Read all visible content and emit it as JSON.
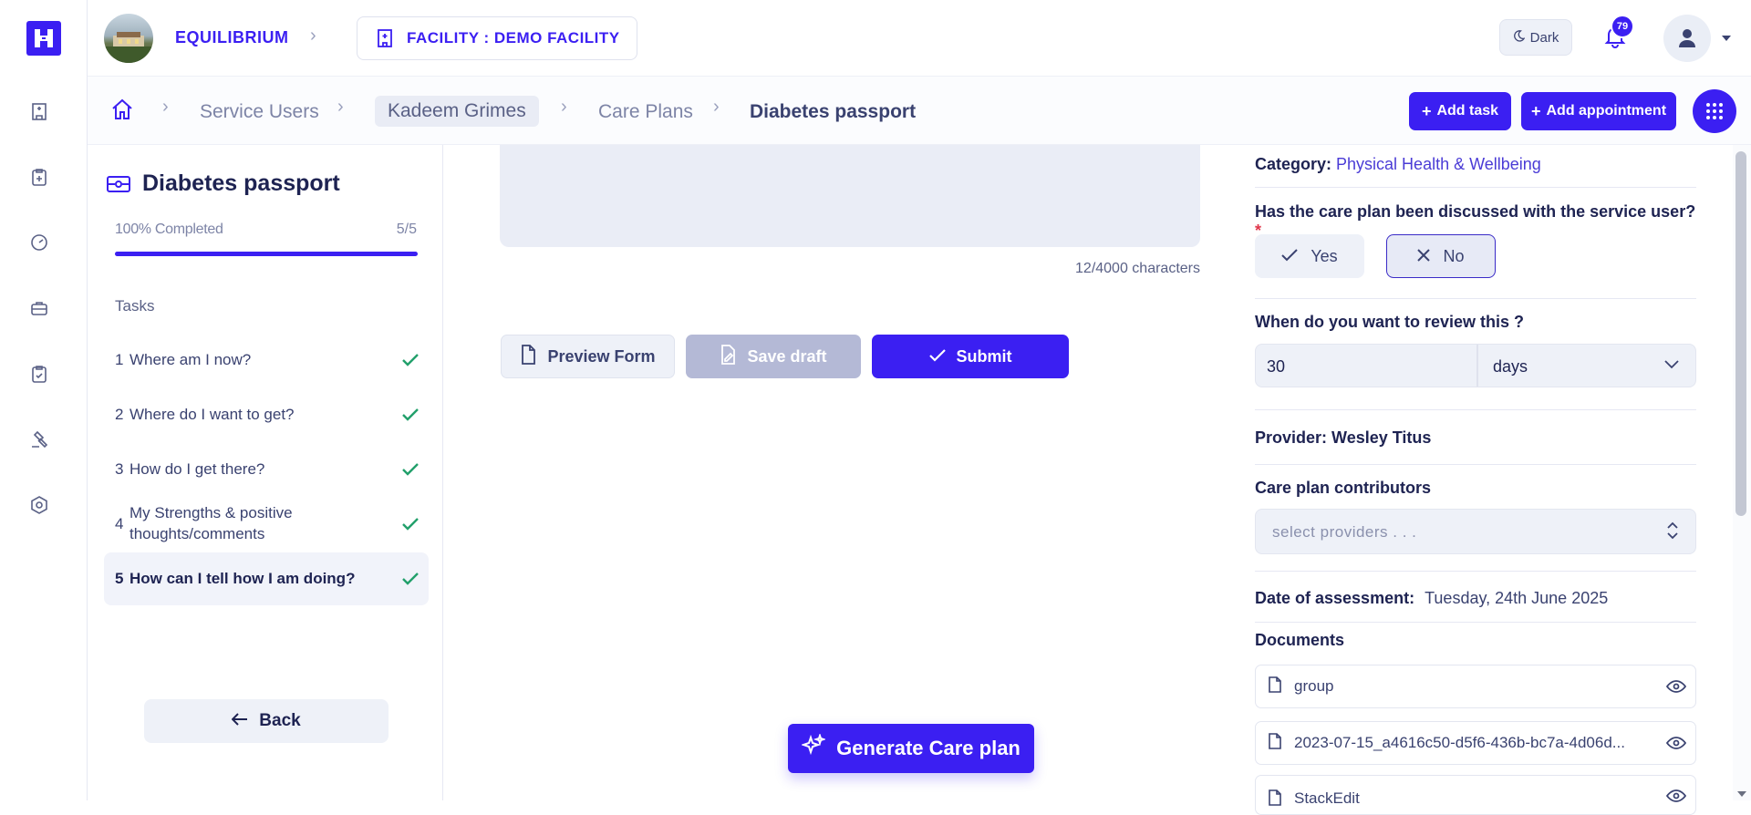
{
  "topbar": {
    "org_name": "EQUILIBRIUM",
    "facility_label": "FACILITY : DEMO FACILITY",
    "dark_toggle_label": "Dark",
    "notification_count": "79"
  },
  "breadcrumb": {
    "items": [
      "Service Users",
      "Kadeem Grimes",
      "Care Plans",
      "Diabetes passport"
    ]
  },
  "actions": {
    "add_task_label": "Add task",
    "add_appointment_label": "Add appointment"
  },
  "left_panel": {
    "title": "Diabetes passport",
    "progress_label": "100% Completed",
    "progress_count": "5/5",
    "progress_fraction": 1.0,
    "tasks_heading": "Tasks",
    "tasks": [
      {
        "num": "1",
        "label": "Where am I now?"
      },
      {
        "num": "2",
        "label": "Where do I want to get?"
      },
      {
        "num": "3",
        "label": "How do I get there?"
      },
      {
        "num": "4",
        "label": "My Strengths & positive thoughts/comments"
      },
      {
        "num": "5",
        "label": "How can I tell how I am doing?"
      }
    ],
    "back_label": "Back"
  },
  "main": {
    "char_count": "12/4000 characters",
    "preview_label": "Preview Form",
    "save_draft_label": "Save draft",
    "submit_label": "Submit",
    "generate_label": "Generate Care plan"
  },
  "right_panel": {
    "category_label": "Category:",
    "category_value": "Physical Health & Wellbeing",
    "discussed_question": "Has the care plan been discussed with the service user?",
    "required_mark": "*",
    "yes_label": "Yes",
    "no_label": "No",
    "review_question": "When do you want to review this ?",
    "review_value": "30",
    "review_unit": "days",
    "provider_text": "Provider: Wesley Titus",
    "contributors_label": "Care plan contributors",
    "contributors_placeholder": "select providers . . .",
    "assessment_label": "Date of assessment:",
    "assessment_value": "Tuesday, 24th June 2025",
    "documents_label": "Documents",
    "documents": [
      "group",
      "2023-07-15_a4616c50-d5f6-436b-bc7a-4d06d...",
      "StackEdit"
    ]
  },
  "colors": {
    "primary": "#3b1ff2",
    "success": "#22a06b",
    "text": "#1e2352"
  }
}
